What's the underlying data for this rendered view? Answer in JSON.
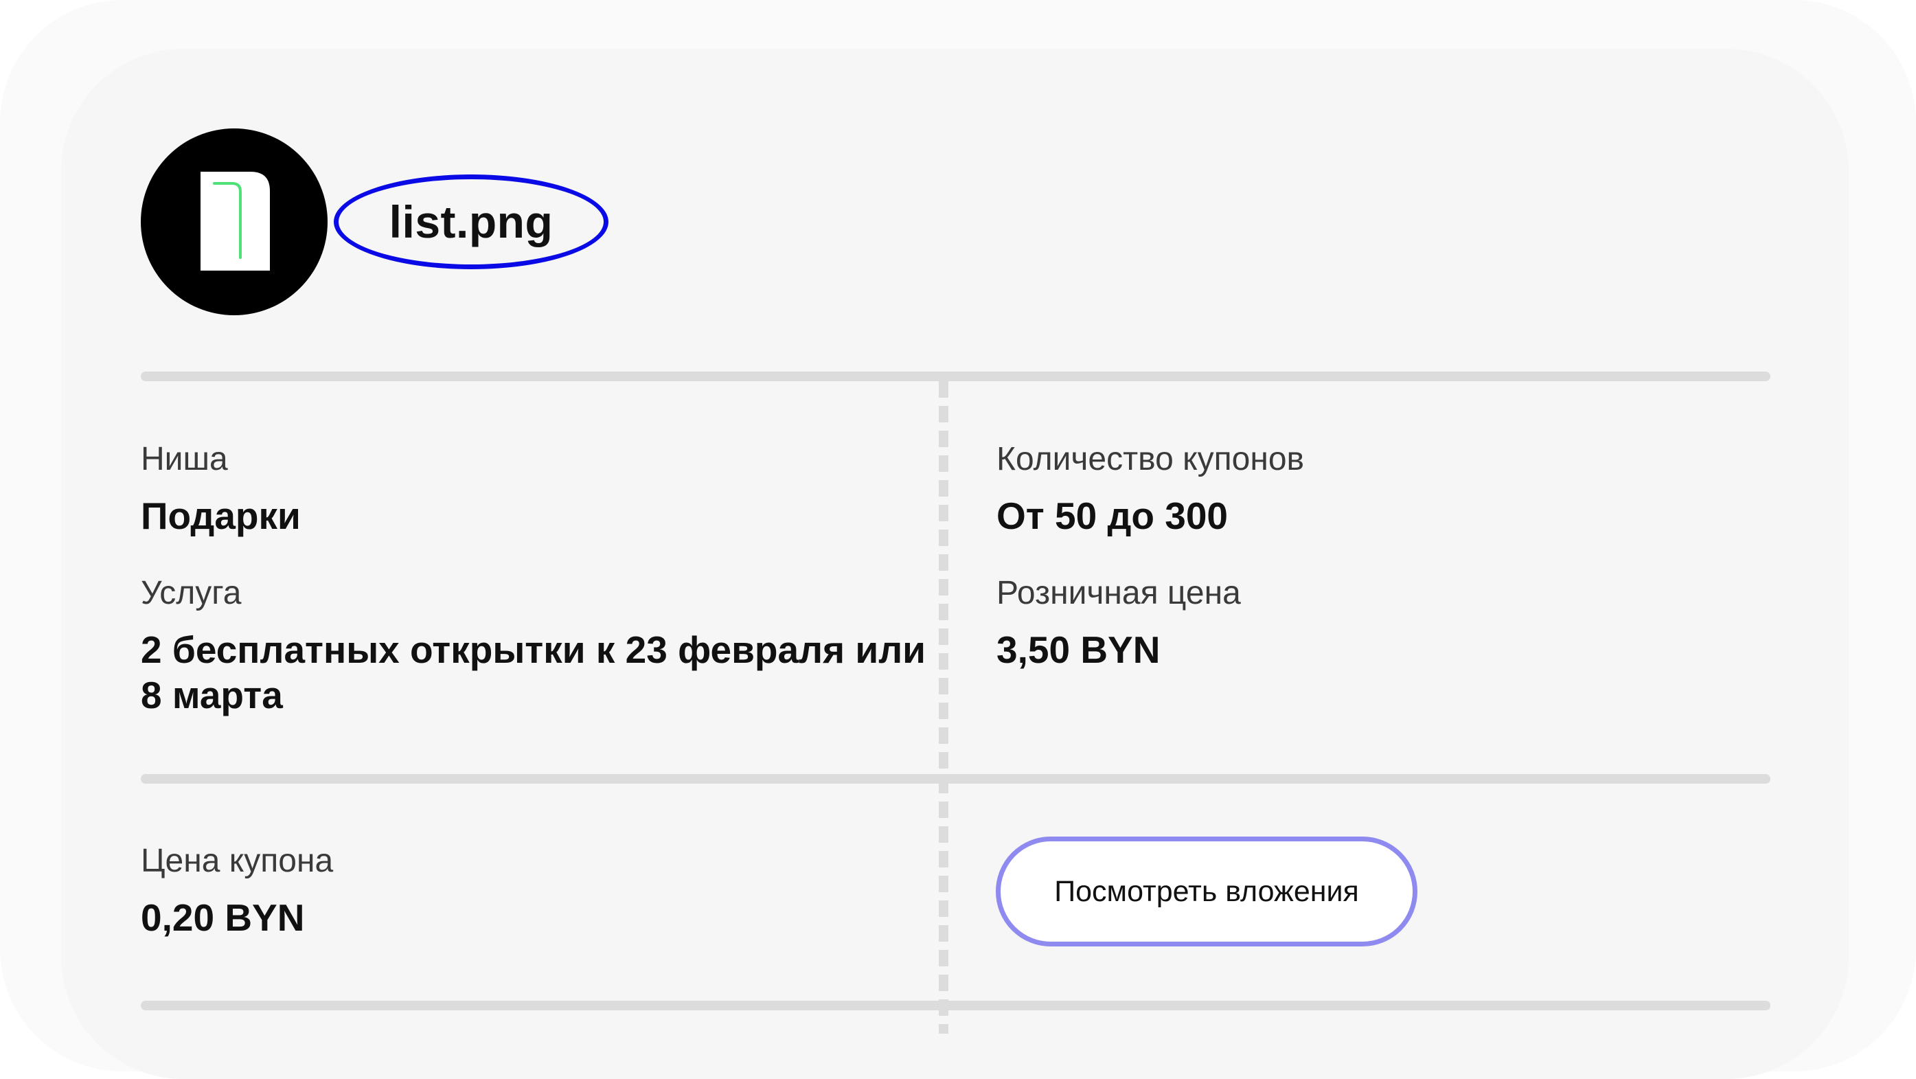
{
  "file": {
    "name": "list.png",
    "icon": "document-icon",
    "highlight_color": "#0a0ae6"
  },
  "details": {
    "niche": {
      "label": "Ниша",
      "value": "Подарки"
    },
    "service": {
      "label": "Услуга",
      "value": "2 бесплатных открытки к 23 февраля или 8 марта"
    },
    "coupon_count": {
      "label": "Количество купонов",
      "value": "От 50 до 300"
    },
    "retail_price": {
      "label": "Розничная цена",
      "value": "3,50 BYN"
    },
    "coupon_price": {
      "label": "Цена купона",
      "value": "0,20 BYN"
    }
  },
  "actions": {
    "view_attachments": "Посмотреть вложения",
    "button_border_color": "#8f8af0"
  }
}
